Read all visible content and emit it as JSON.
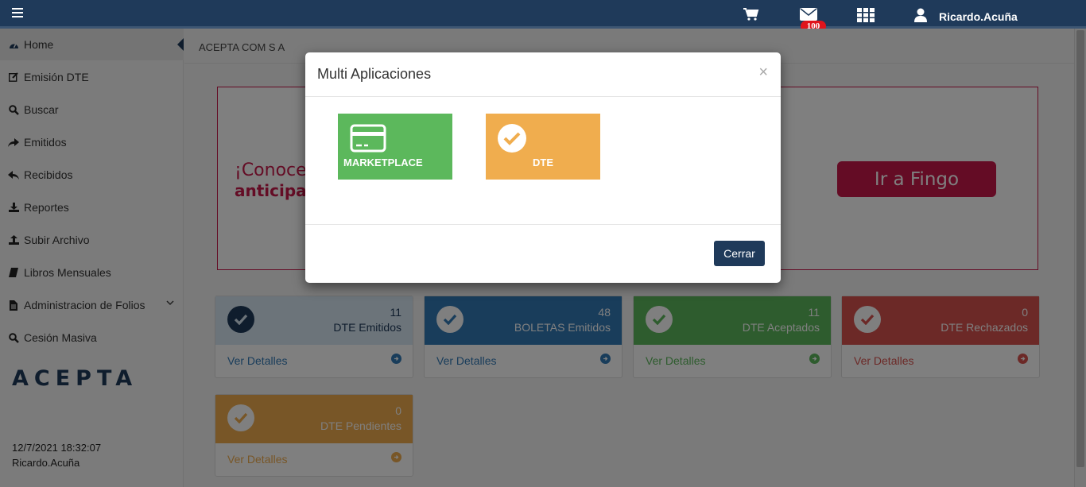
{
  "topbar": {
    "username": "Ricardo.Acuña",
    "mail_badge": "100"
  },
  "sidebar": {
    "items": [
      {
        "label": "Home",
        "icon": "dashboard-icon"
      },
      {
        "label": "Emisión DTE",
        "icon": "edit-icon"
      },
      {
        "label": "Buscar",
        "icon": "search-icon"
      },
      {
        "label": "Emitidos",
        "icon": "share-icon"
      },
      {
        "label": "Recibidos",
        "icon": "reply-icon"
      },
      {
        "label": "Reportes",
        "icon": "download-icon"
      },
      {
        "label": "Subir Archivo",
        "icon": "upload-icon"
      },
      {
        "label": "Libros Mensuales",
        "icon": "book-icon"
      },
      {
        "label": "Administracion de Folios",
        "icon": "file-icon"
      },
      {
        "label": "Cesión Masiva",
        "icon": "search-icon"
      }
    ],
    "logo": "ACEPTA",
    "date": "12/7/2021 18:32:07",
    "user": "Ricardo.Acuña"
  },
  "main": {
    "company": "ACEPTA COM S A",
    "banner_line1": "¡Conoce",
    "banner_line2": "anticipa",
    "banner_button": "Ir a Fingo",
    "cards": [
      {
        "count": "11",
        "label": "DTE Emitidos",
        "link": "Ver Detalles",
        "color": "#d9e8f5"
      },
      {
        "count": "48",
        "label": "BOLETAS Emitidos",
        "link": "Ver Detalles",
        "color": "#337ab7"
      },
      {
        "count": "11",
        "label": "DTE Aceptados",
        "link": "Ver Detalles",
        "color": "#5cb85c"
      },
      {
        "count": "0",
        "label": "DTE Rechazados",
        "link": "Ver Detalles",
        "color": "#d9534f"
      },
      {
        "count": "0",
        "label": "DTE Pendientes",
        "link": "Ver Detalles",
        "color": "#f0ad4e"
      }
    ]
  },
  "modal": {
    "title": "Multi Aplicaciones",
    "close": "×",
    "tiles": [
      {
        "label": "MARKETPLACE",
        "icon": "credit-card-icon",
        "color": "#5cb85c"
      },
      {
        "label": "DTE",
        "icon": "check-circle-icon",
        "color": "#f0ad4e"
      }
    ],
    "cerrar_label": "Cerrar"
  }
}
